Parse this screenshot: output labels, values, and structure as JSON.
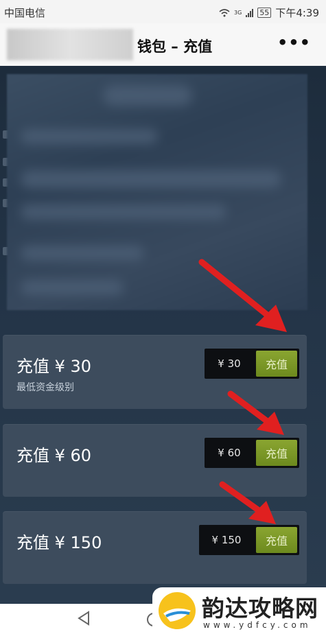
{
  "status_bar": {
    "carrier": "中国电信",
    "network": "3G",
    "battery": "55",
    "time": "下午4:39"
  },
  "header": {
    "title": "钱包 – 充值",
    "more_icon": "more-dots-icon",
    "more_label": "•••"
  },
  "cards": [
    {
      "label": "充值 ¥ 30",
      "sublabel": "最低资金级别",
      "price": "¥ 30",
      "button": "充值"
    },
    {
      "label": "充值 ¥ 60",
      "sublabel": "",
      "price": "¥ 60",
      "button": "充值"
    },
    {
      "label": "充值 ¥ 150",
      "sublabel": "",
      "price": "¥ 150",
      "button": "充值"
    }
  ],
  "colors": {
    "background": "#233447",
    "card": "#3d4c5d",
    "button_green": "#7a9626",
    "arrow_red": "#e02020"
  },
  "watermark": {
    "brand": "韵达攻略网",
    "url": "www.ydfcy.com"
  }
}
